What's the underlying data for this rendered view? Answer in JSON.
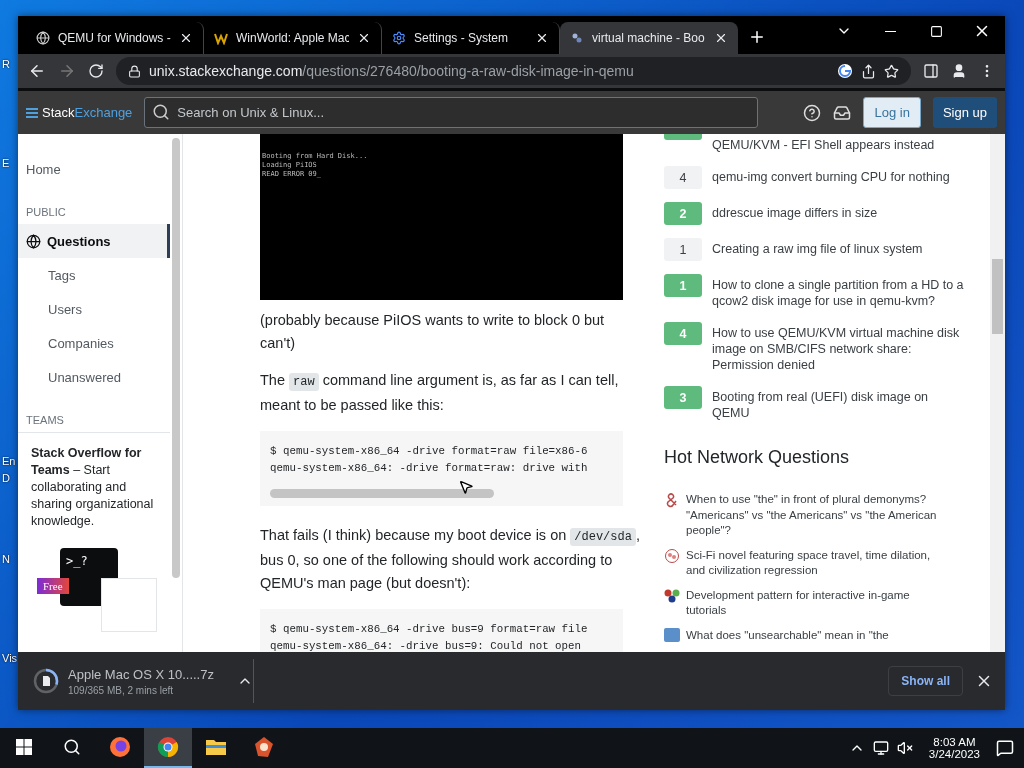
{
  "desktop_labels": [
    {
      "text": "R"
    },
    {
      "text": "E"
    },
    {
      "text": "En"
    },
    {
      "text": "D"
    },
    {
      "text": "N"
    },
    {
      "text": "Vis"
    }
  ],
  "tabs": [
    {
      "title": "QEMU for Windows -",
      "kind": "globe",
      "selected": false
    },
    {
      "title": "WinWorld: Apple Mac",
      "kind": "winworld",
      "selected": false
    },
    {
      "title": "Settings - System",
      "kind": "gear",
      "selected": false
    },
    {
      "title": "virtual machine - Boo",
      "kind": "stack",
      "selected": true
    }
  ],
  "address_bar": {
    "host": "unix.stackexchange.com",
    "path": "/questions/276480/booting-a-raw-disk-image-in-qemu"
  },
  "site_header": {
    "logo_first": "Stack",
    "logo_second": "Exchange",
    "search_placeholder": "Search on Unix & Linux...",
    "login": "Log in",
    "signup": "Sign up"
  },
  "sidebar": {
    "home": "Home",
    "public_heading": "PUBLIC",
    "items": [
      {
        "label": "Questions",
        "kind": "main",
        "selected": true
      },
      {
        "label": "Tags",
        "kind": "sub",
        "selected": false
      },
      {
        "label": "Users",
        "kind": "sub",
        "selected": false
      },
      {
        "label": "Companies",
        "kind": "sub",
        "selected": false
      },
      {
        "label": "Unanswered",
        "kind": "sub",
        "selected": false
      }
    ],
    "teams_heading": "TEAMS",
    "promo_text": "**Stack Overflow for Teams** – Start collaborating and sharing organizational knowledge.",
    "promo_prompt": ">_?",
    "promo_badge": "Free"
  },
  "post": {
    "console_lines": [
      "Booting from Hard Disk...",
      "Loading PiIOS",
      "READ ERROR 09_"
    ],
    "blocks": [
      {
        "kind": "para",
        "segments": [
          {
            "kind": "text",
            "text": "(probably because PiIOS wants to write to block 0 but can't)"
          }
        ]
      },
      {
        "kind": "para",
        "segments": [
          {
            "kind": "text",
            "text": "The "
          },
          {
            "kind": "code",
            "text": "raw"
          },
          {
            "kind": "text",
            "text": " command line argument is, as far as I can tell, meant to be passed like this:"
          }
        ]
      },
      {
        "kind": "code",
        "lines": [
          "$ qemu-system-x86_64 -drive format=raw file=x86-6",
          "qemu-system-x86_64: -drive format=raw: drive with"
        ]
      },
      {
        "kind": "para",
        "segments": [
          {
            "kind": "text",
            "text": "That fails (I think) because my boot device is on "
          },
          {
            "kind": "code",
            "text": "/dev/sda"
          },
          {
            "kind": "text",
            "text": ", bus 0, so one of the following should work according to QEMU's man page (but doesn't):"
          }
        ]
      },
      {
        "kind": "code",
        "lines": [
          "$ qemu-system-x86_64 -drive bus=9 format=raw file",
          "qemu-system-x86_64: -drive bus=9: Could not open"
        ]
      }
    ]
  },
  "related": [
    {
      "title": "QEMU/KVM - EFI Shell appears instead",
      "answered": true
    },
    {
      "score": "4",
      "title": "qemu-img convert burning CPU for nothing",
      "answered": false
    },
    {
      "score": "2",
      "title": "ddrescue image differs in size",
      "answered": true
    },
    {
      "score": "1",
      "title": "Creating a raw img file of linux system",
      "answered": false
    },
    {
      "score": "1",
      "title": "How to clone a single partition from a HD to a qcow2 disk image for use in qemu-kvm?",
      "answered": true
    },
    {
      "score": "4",
      "title": "How to use QEMU/KVM virtual machine disk image on SMB/CIFS network share: Permission denied",
      "answered": true
    },
    {
      "score": "3",
      "title": "Booting from real (UEFI) disk image on QEMU",
      "answered": true
    }
  ],
  "hot_network": {
    "heading": "Hot Network Questions",
    "items": [
      {
        "kind": "english",
        "title": "When to use \"the\" in front of plural demonyms? \"Americans\" vs \"the Americans\" vs \"the American people\"?"
      },
      {
        "kind": "scifi",
        "title": "Sci-Fi novel featuring space travel, time dilation, and civilization regression"
      },
      {
        "kind": "gamedev",
        "title": "Development pattern for interactive in-game tutorials"
      },
      {
        "kind": "hermeneutics",
        "title": "What does \"unsearchable\" mean in \"the"
      }
    ]
  },
  "download": {
    "file": "Apple Mac OS X 10.....7z",
    "status": "109/365 MB, 2 mins left",
    "level": 0.3,
    "show_all": "Show all"
  },
  "taskbar": {
    "apps": [
      {
        "kind": "firefox",
        "active": false
      },
      {
        "kind": "chrome",
        "active": true
      },
      {
        "kind": "explorer",
        "active": false
      },
      {
        "kind": "paint",
        "active": false
      }
    ],
    "time": "8:03 AM",
    "date": "3/24/2023"
  }
}
